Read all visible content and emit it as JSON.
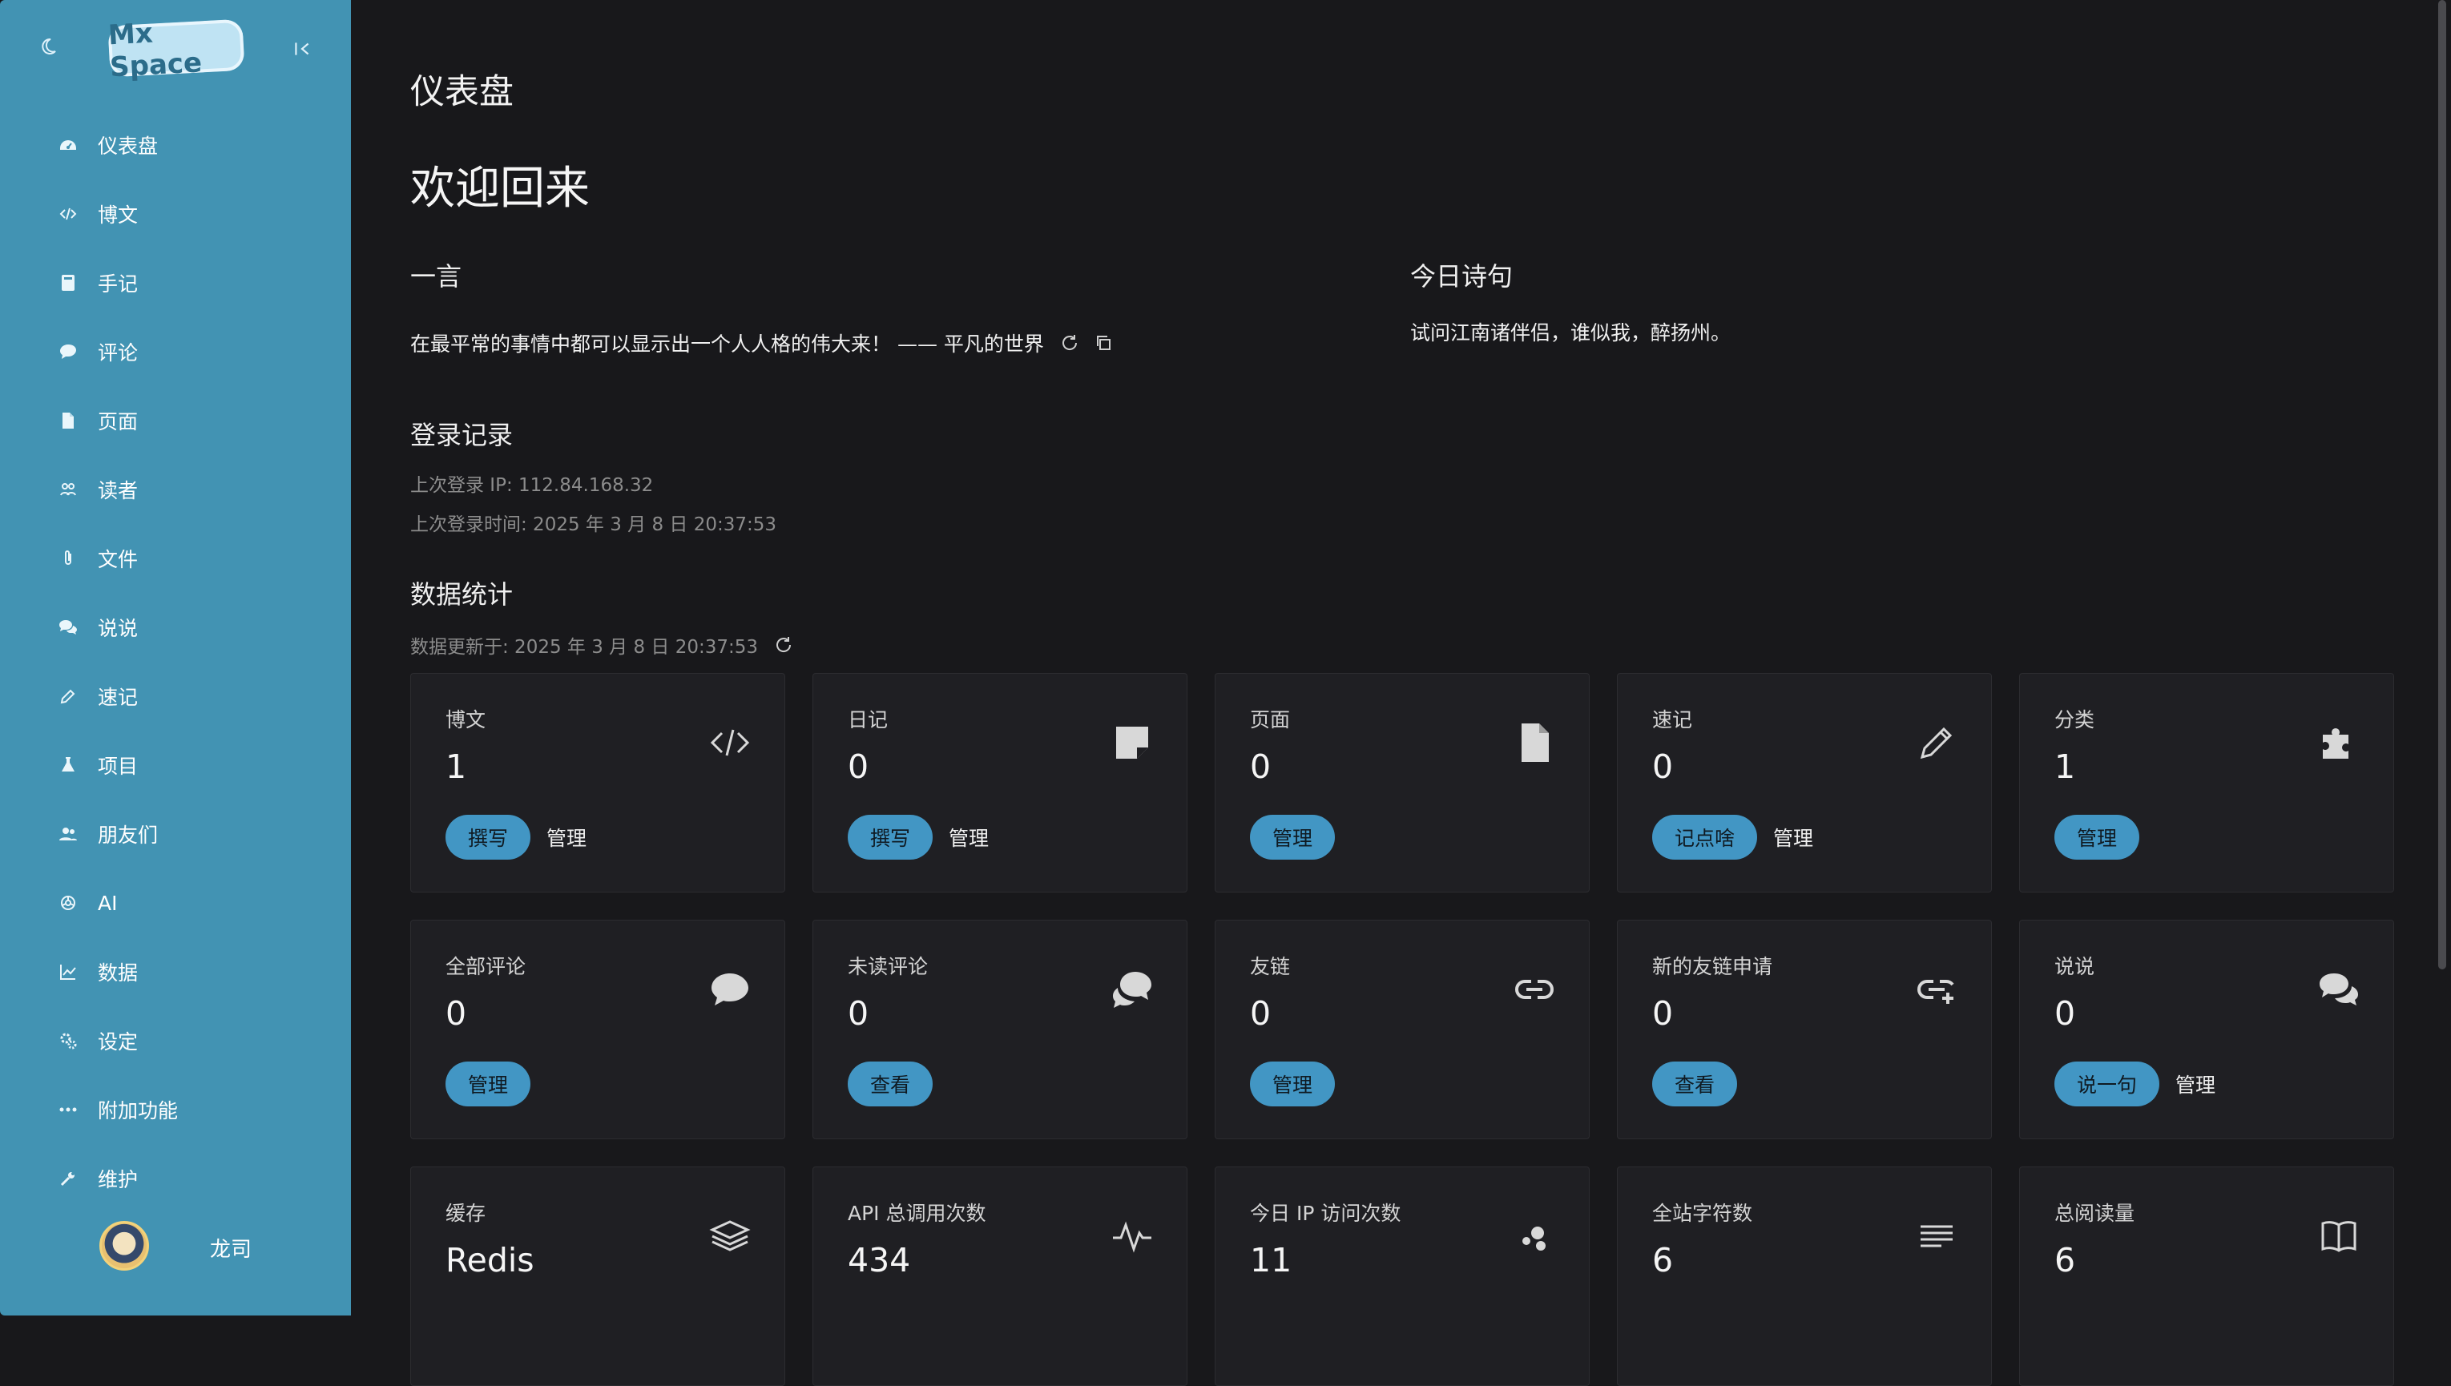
{
  "sidebar": {
    "logo_text": "Mx Space",
    "items": [
      {
        "label": "仪表盘"
      },
      {
        "label": "博文"
      },
      {
        "label": "手记"
      },
      {
        "label": "评论"
      },
      {
        "label": "页面"
      },
      {
        "label": "读者"
      },
      {
        "label": "文件"
      },
      {
        "label": "说说"
      },
      {
        "label": "速记"
      },
      {
        "label": "项目"
      },
      {
        "label": "朋友们"
      },
      {
        "label": "AI"
      },
      {
        "label": "数据"
      },
      {
        "label": "设定"
      },
      {
        "label": "附加功能"
      },
      {
        "label": "维护"
      }
    ],
    "user": {
      "name": "龙司"
    }
  },
  "main": {
    "page_title": "仪表盘",
    "welcome": "欢迎回来",
    "hitokoto": {
      "title": "一言",
      "text": "在最平常的事情中都可以显示出一个人人格的伟大来！ —— 平凡的世界"
    },
    "poem": {
      "title": "今日诗句",
      "text": "试问江南诸伴侣，谁似我，醉扬州。"
    },
    "login": {
      "title": "登录记录",
      "last_ip": "上次登录 IP: 112.84.168.32",
      "last_time": "上次登录时间: 2025 年 3 月 8 日 20:37:53"
    },
    "stats": {
      "title": "数据统计",
      "updated": "数据更新于:  2025 年 3 月 8 日 20:37:53",
      "cards": [
        {
          "label": "博文",
          "value": "1",
          "primary": "撰写",
          "secondary": "管理"
        },
        {
          "label": "日记",
          "value": "0",
          "primary": "撰写",
          "secondary": "管理"
        },
        {
          "label": "页面",
          "value": "0",
          "primary": "管理"
        },
        {
          "label": "速记",
          "value": "0",
          "primary": "记点啥",
          "secondary": "管理"
        },
        {
          "label": "分类",
          "value": "1",
          "primary": "管理"
        },
        {
          "label": "全部评论",
          "value": "0",
          "primary": "管理"
        },
        {
          "label": "未读评论",
          "value": "0",
          "primary": "查看"
        },
        {
          "label": "友链",
          "value": "0",
          "primary": "管理"
        },
        {
          "label": "新的友链申请",
          "value": "0",
          "primary": "查看"
        },
        {
          "label": "说说",
          "value": "0",
          "primary": "说一句",
          "secondary": "管理"
        },
        {
          "label": "缓存",
          "value": "Redis"
        },
        {
          "label": "API 总调用次数",
          "value": "434"
        },
        {
          "label": "今日 IP 访问次数",
          "value": "11"
        },
        {
          "label": "全站字符数",
          "value": "6"
        },
        {
          "label": "总阅读量",
          "value": "6"
        }
      ]
    }
  },
  "colors": {
    "sidebar_bg": "#4293b3",
    "main_bg": "#18181b",
    "card_bg": "#1f1f23",
    "accent": "#4296c4"
  },
  "icons": {
    "nav": [
      "dashboard-icon",
      "code-icon",
      "book-icon",
      "comment-icon",
      "file-icon",
      "readers-icon",
      "paperclip-icon",
      "chat-bubbles-icon",
      "pencil-icon",
      "flask-icon",
      "users-icon",
      "openai-icon",
      "chart-icon",
      "gears-icon",
      "more-icon",
      "wrench-icon"
    ],
    "cards": [
      "code-icon",
      "sticky-note-icon",
      "file-icon",
      "pencil-icon",
      "puzzle-icon",
      "comment-icon",
      "comments-icon",
      "link-icon",
      "link-add-icon",
      "chat-bubbles-icon",
      "layers-icon",
      "pulse-icon",
      "bubbles-icon",
      "text-lines-icon",
      "open-book-icon"
    ]
  }
}
